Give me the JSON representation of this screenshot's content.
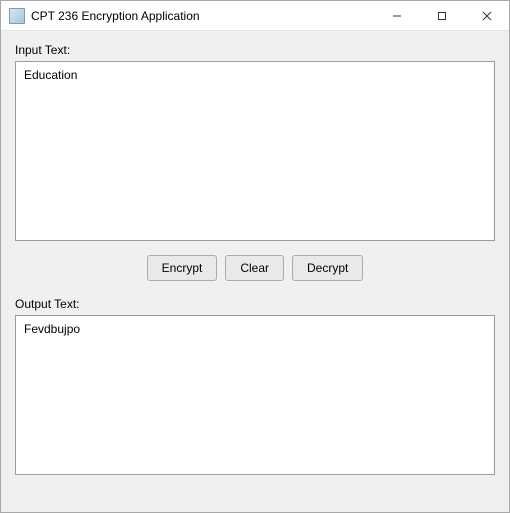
{
  "window": {
    "title": "CPT 236 Encryption Application"
  },
  "labels": {
    "input": "Input Text:",
    "output": "Output Text:"
  },
  "fields": {
    "input_value": "Education",
    "output_value": "Fevdbujpo"
  },
  "buttons": {
    "encrypt": "Encrypt",
    "clear": "Clear",
    "decrypt": "Decrypt"
  }
}
